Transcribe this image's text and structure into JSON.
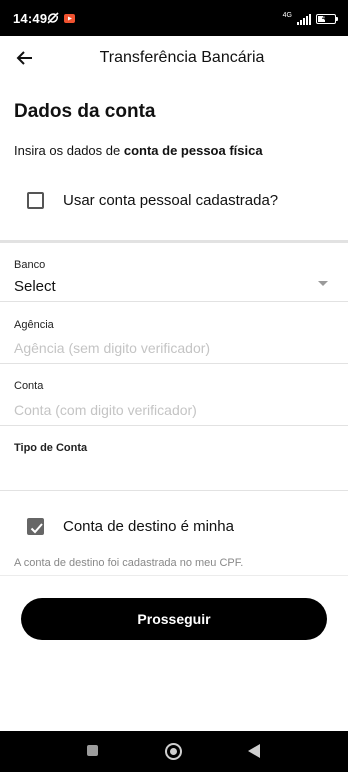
{
  "status_bar": {
    "time": "14:49",
    "network": "4G",
    "battery": "44",
    "battery_level": 0.44
  },
  "header": {
    "title": "Transferência Bancária",
    "back_icon": "arrow-left-icon"
  },
  "section": {
    "title": "Dados da conta",
    "instruction_prefix": "Insira os dados de ",
    "instruction_bold": "conta de pessoa física"
  },
  "use_saved_account": {
    "label": "Usar conta pessoal cadastrada?",
    "checked": false
  },
  "fields": {
    "bank": {
      "label": "Banco",
      "value": "Select"
    },
    "agency": {
      "label": "Agência",
      "placeholder": "Agência (sem digito verificador)"
    },
    "account": {
      "label": "Conta",
      "placeholder": "Conta (com digito verificador)"
    },
    "account_type": {
      "label": "Tipo de Conta"
    }
  },
  "destination_mine": {
    "label": "Conta de destino é minha",
    "checked": true,
    "hint": "A conta de destino foi cadastrada no meu CPF."
  },
  "continue_button": {
    "label": "Prosseguir"
  },
  "colors": {
    "primary_button": "#000000",
    "placeholder": "#c4c4c4",
    "divider": "#e2e2e2"
  }
}
